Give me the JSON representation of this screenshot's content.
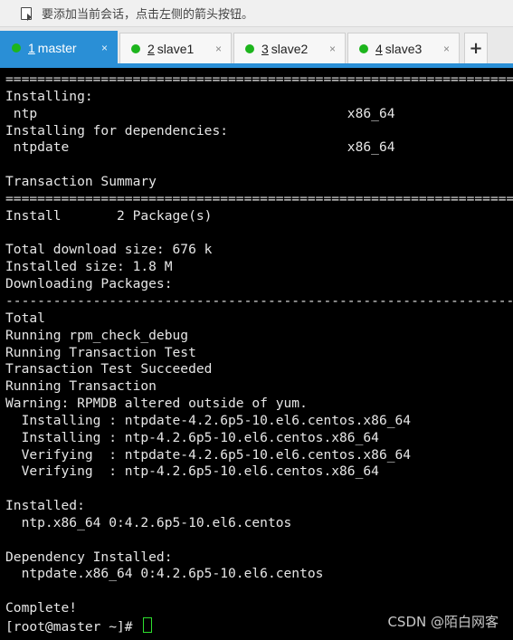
{
  "hint": {
    "icon": "add-session-icon",
    "text": "要添加当前会话，点击左侧的箭头按钮。"
  },
  "tabs": [
    {
      "number": "1",
      "name": "master",
      "close": "×",
      "active": true
    },
    {
      "number": "2",
      "name": "slave1",
      "close": "×",
      "active": false
    },
    {
      "number": "3",
      "name": "slave2",
      "close": "×",
      "active": false
    },
    {
      "number": "4",
      "name": "slave3",
      "close": "×",
      "active": false
    }
  ],
  "add_tab": "+",
  "terminal": {
    "lines": [
      "================================================================================================",
      "Installing:",
      " ntp                                       x86_64",
      "Installing for dependencies:",
      " ntpdate                                   x86_64",
      "",
      "Transaction Summary",
      "================================================================================================",
      "Install       2 Package(s)",
      "",
      "Total download size: 676 k",
      "Installed size: 1.8 M",
      "Downloading Packages:",
      "------------------------------------------------------------------------------------------------",
      "Total",
      "Running rpm_check_debug",
      "Running Transaction Test",
      "Transaction Test Succeeded",
      "Running Transaction",
      "Warning: RPMDB altered outside of yum.",
      "  Installing : ntpdate-4.2.6p5-10.el6.centos.x86_64",
      "  Installing : ntp-4.2.6p5-10.el6.centos.x86_64",
      "  Verifying  : ntpdate-4.2.6p5-10.el6.centos.x86_64",
      "  Verifying  : ntp-4.2.6p5-10.el6.centos.x86_64",
      "",
      "Installed:",
      "  ntp.x86_64 0:4.2.6p5-10.el6.centos",
      "",
      "Dependency Installed:",
      "  ntpdate.x86_64 0:4.2.6p5-10.el6.centos",
      "",
      "Complete!"
    ],
    "prompt": "[root@master ~]# "
  },
  "watermark": "CSDN @陌白网客",
  "colors": {
    "tab_active": "#2a8fd6",
    "status_dot": "#1db51d",
    "cursor": "#2ee02e"
  }
}
